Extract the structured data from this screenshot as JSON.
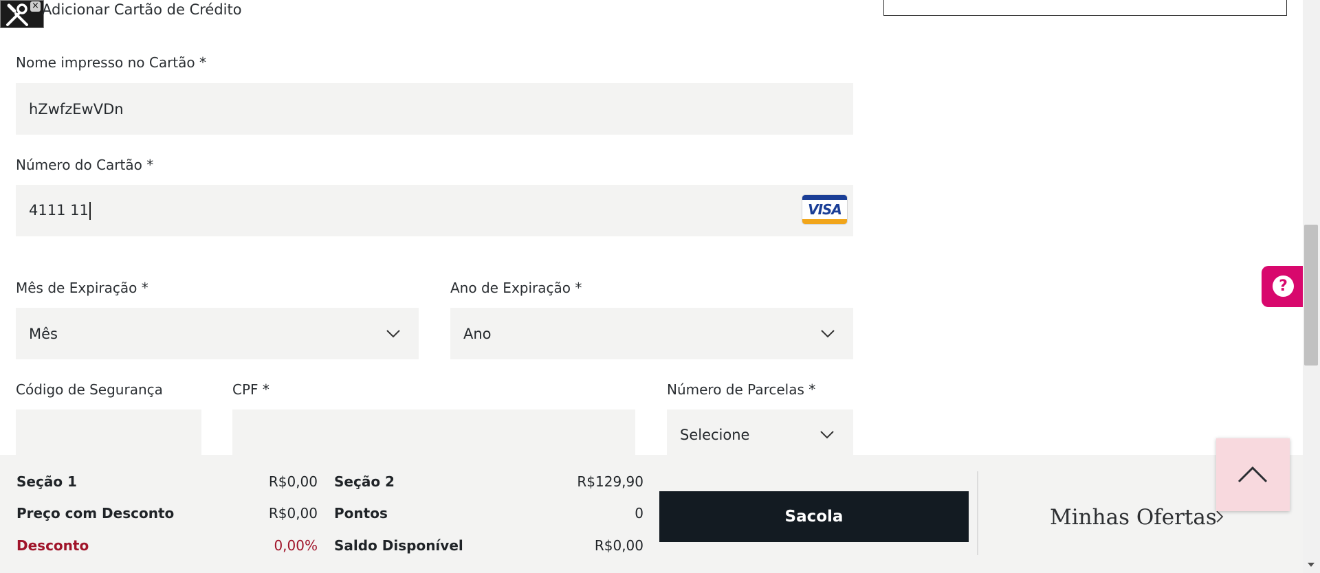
{
  "devtool": {
    "icon": "tools-icon",
    "close": "×"
  },
  "section_title": "Adicionar Cartão de Crédito",
  "form": {
    "name_label": "Nome impresso no Cartão *",
    "name_value": "hZwfzEwVDn",
    "number_label": "Número do Cartão *",
    "number_value": "4111 11",
    "card_brand": "VISA",
    "month_label": "Mês de Expiração *",
    "month_value": "Mês",
    "year_label": "Ano de Expiração *",
    "year_value": "Ano",
    "cvv_label": "Código de Segurança",
    "cvv_value": "",
    "cpf_label": "CPF *",
    "cpf_value": "",
    "installments_label": "Número de Parcelas *",
    "installments_value": "Selecione"
  },
  "help_button": {
    "symbol": "?"
  },
  "summary": {
    "section1_label": "Seção 1",
    "section1_value": "R$0,00",
    "discount_price_label": "Preço com Desconto",
    "discount_price_value": "R$0,00",
    "discount_label": "Desconto",
    "discount_value": "0,00%",
    "section2_label": "Seção 2",
    "section2_value": "R$129,90",
    "points_label": "Pontos",
    "points_value": "0",
    "balance_label": "Saldo Disponível",
    "balance_value": "R$0,00"
  },
  "bag_button": "Sacola",
  "offers_link": "Minhas Ofertas",
  "colors": {
    "accent_pink": "#d8086d",
    "dark_button": "#131b22",
    "discount_red": "#a0142a"
  }
}
